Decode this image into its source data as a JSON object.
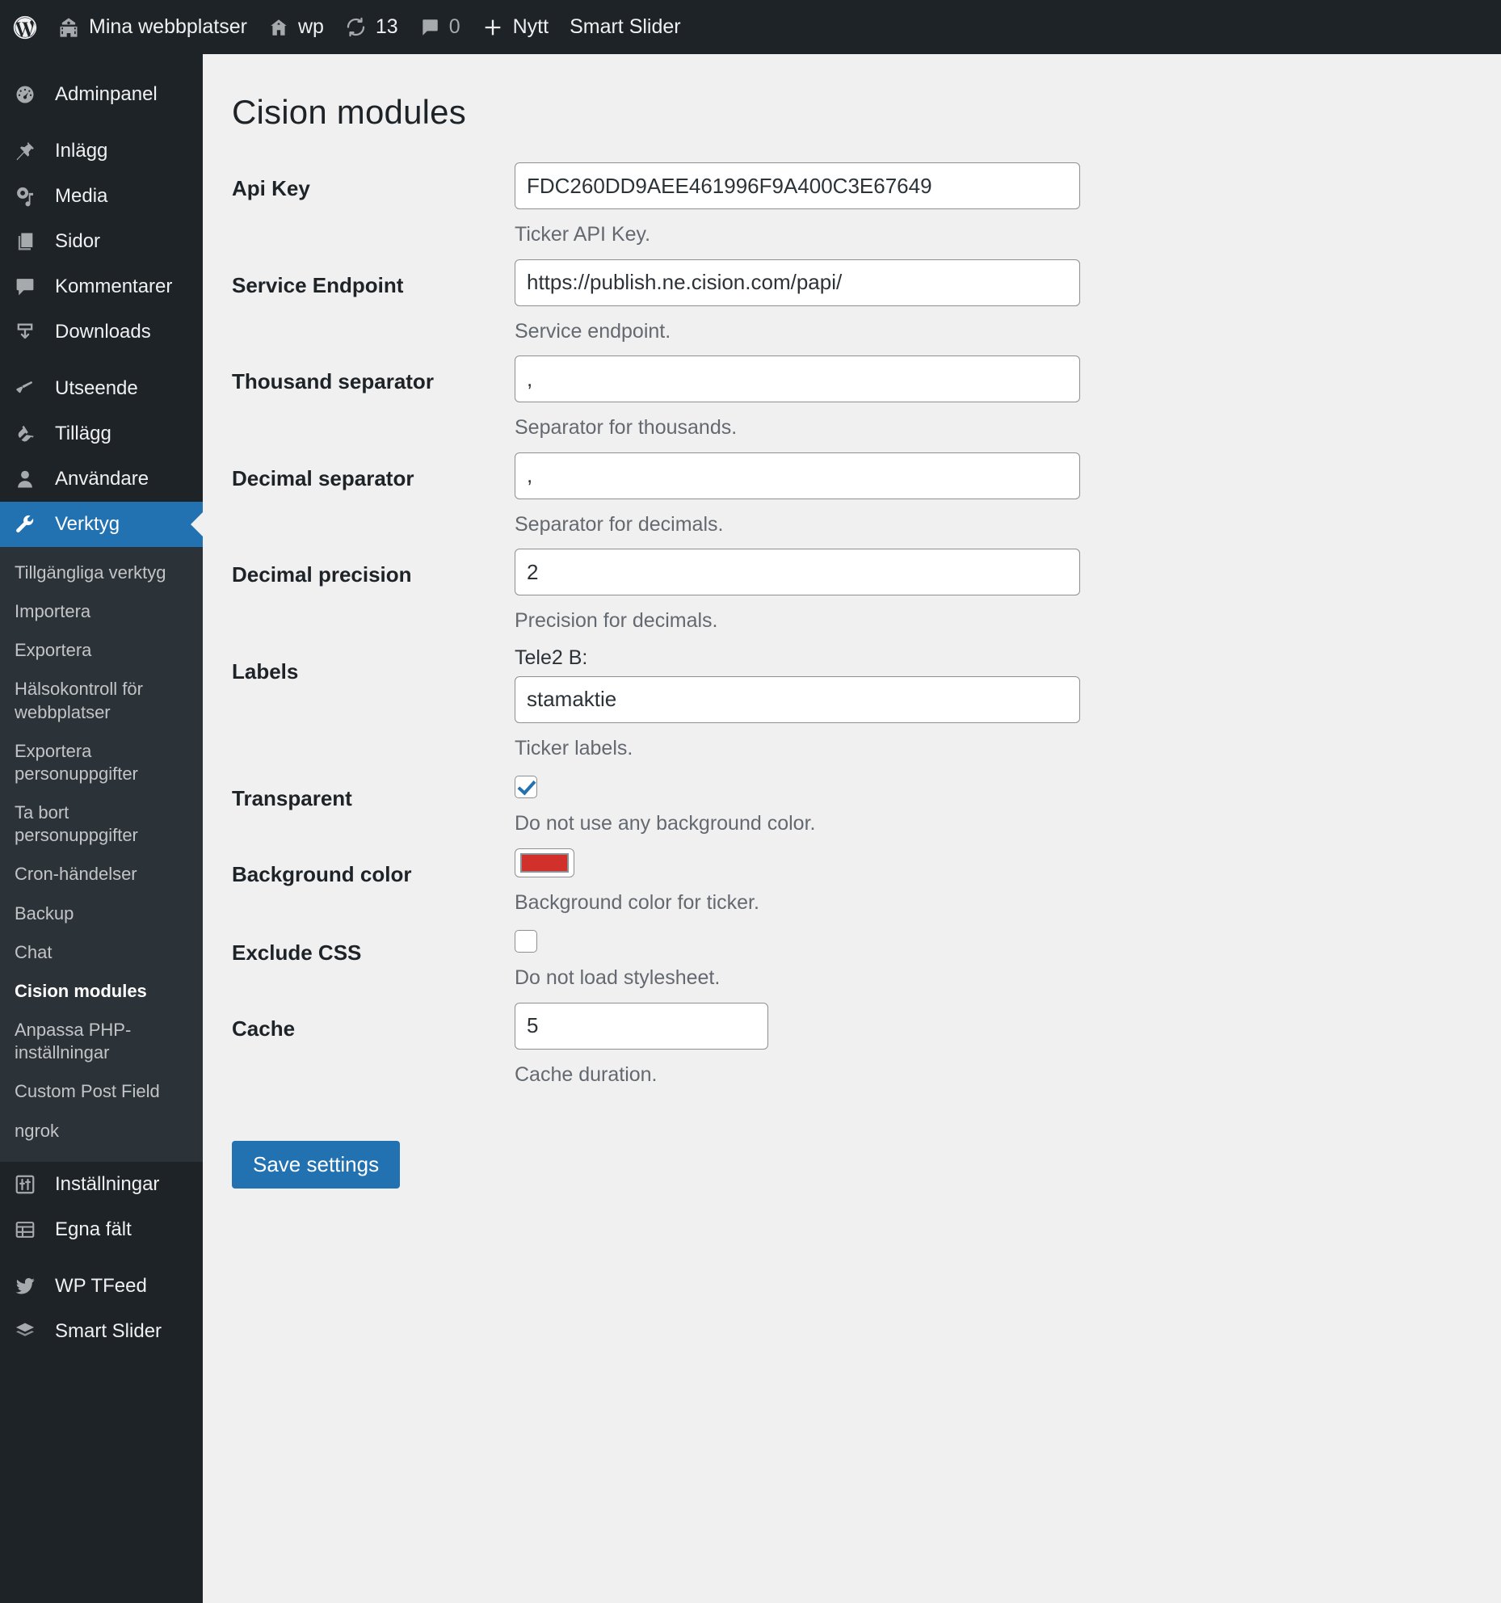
{
  "adminbar": {
    "items": [
      {
        "icon": "wordpress-logo-icon",
        "label": ""
      },
      {
        "icon": "multisite-icon",
        "label": "Mina webbplatser"
      },
      {
        "icon": "home-icon",
        "label": "wp"
      },
      {
        "icon": "updates-icon",
        "label": "13"
      },
      {
        "icon": "comments-icon",
        "label": "0"
      },
      {
        "icon": "plus-icon",
        "label": "Nytt"
      },
      {
        "icon": "",
        "label": "Smart Slider"
      }
    ]
  },
  "sidebar": {
    "top_items": [
      {
        "label": "Adminpanel",
        "icon": "dashboard-icon"
      }
    ],
    "content_items": [
      {
        "label": "Inlägg",
        "icon": "pin-icon"
      },
      {
        "label": "Media",
        "icon": "media-icon"
      },
      {
        "label": "Sidor",
        "icon": "pages-icon"
      },
      {
        "label": "Kommentarer",
        "icon": "comment-icon"
      },
      {
        "label": "Downloads",
        "icon": "download-icon"
      }
    ],
    "admin_items": [
      {
        "label": "Utseende",
        "icon": "appearance-brush-icon"
      },
      {
        "label": "Tillägg",
        "icon": "plugin-plug-icon"
      },
      {
        "label": "Användare",
        "icon": "user-icon"
      }
    ],
    "current_item": {
      "label": "Verktyg",
      "icon": "tools-wrench-icon"
    },
    "submenu": [
      {
        "label": "Tillgängliga verktyg",
        "current": false
      },
      {
        "label": "Importera",
        "current": false
      },
      {
        "label": "Exportera",
        "current": false
      },
      {
        "label": "Hälsokontroll för webbplatser",
        "current": false
      },
      {
        "label": "Exportera personuppgifter",
        "current": false
      },
      {
        "label": "Ta bort personuppgifter",
        "current": false
      },
      {
        "label": "Cron-händelser",
        "current": false
      },
      {
        "label": "Backup",
        "current": false
      },
      {
        "label": "Chat",
        "current": false
      },
      {
        "label": "Cision modules",
        "current": true
      },
      {
        "label": "Anpassa PHP-inställningar",
        "current": false
      },
      {
        "label": "Custom Post Field",
        "current": false
      },
      {
        "label": "ngrok",
        "current": false
      }
    ],
    "settings_items": [
      {
        "label": "Inställningar",
        "icon": "settings-sliders-icon"
      },
      {
        "label": "Egna fält",
        "icon": "custom-fields-grid-icon"
      }
    ],
    "plugin_items": [
      {
        "label": "WP TFeed",
        "icon": "twitter-bird-icon"
      },
      {
        "label": "Smart Slider",
        "icon": "slider-layers-icon"
      }
    ]
  },
  "main": {
    "page_title": "Cision modules",
    "fields": [
      {
        "label": "Api Key",
        "type": "text",
        "value": "FDC260DD9AEE461996F9A400C3E67649",
        "help": "Ticker API Key.",
        "name": "api-key"
      },
      {
        "label": "Service Endpoint",
        "type": "text",
        "value": "https://publish.ne.cision.com/papi/",
        "help": "Service endpoint.",
        "name": "service-endpoint"
      },
      {
        "label": "Thousand separator",
        "type": "text",
        "value": ",",
        "help": "Separator for thousands.",
        "name": "thousand-separator"
      },
      {
        "label": "Decimal separator",
        "type": "text",
        "value": ",",
        "help": "Separator for decimals.",
        "name": "decimal-separator"
      },
      {
        "label": "Decimal precision",
        "type": "text",
        "value": "2",
        "help": "Precision for decimals.",
        "name": "decimal-precision"
      },
      {
        "label": "Labels",
        "type": "labeled-text",
        "sublabel": "Tele2 B:",
        "value": "stamaktie",
        "help": "Ticker labels.",
        "name": "labels"
      },
      {
        "label": "Transparent",
        "type": "checkbox",
        "checked": true,
        "help": "Do not use any background color.",
        "name": "transparent"
      },
      {
        "label": "Background color",
        "type": "color",
        "color": "#d1312a",
        "help": "Background color for ticker.",
        "name": "background-color"
      },
      {
        "label": "Exclude CSS",
        "type": "checkbox",
        "checked": false,
        "help": "Do not load stylesheet.",
        "name": "exclude-css"
      },
      {
        "label": "Cache",
        "type": "text-small",
        "value": "5",
        "help": "Cache duration.",
        "name": "cache"
      }
    ],
    "save_label": "Save settings"
  },
  "colors": {
    "accent": "#2271b1",
    "sidebar_bg": "#1d2327",
    "submenu_bg": "#2c3338",
    "content_bg": "#f0f0f1",
    "swatch_red": "#d1312a"
  }
}
